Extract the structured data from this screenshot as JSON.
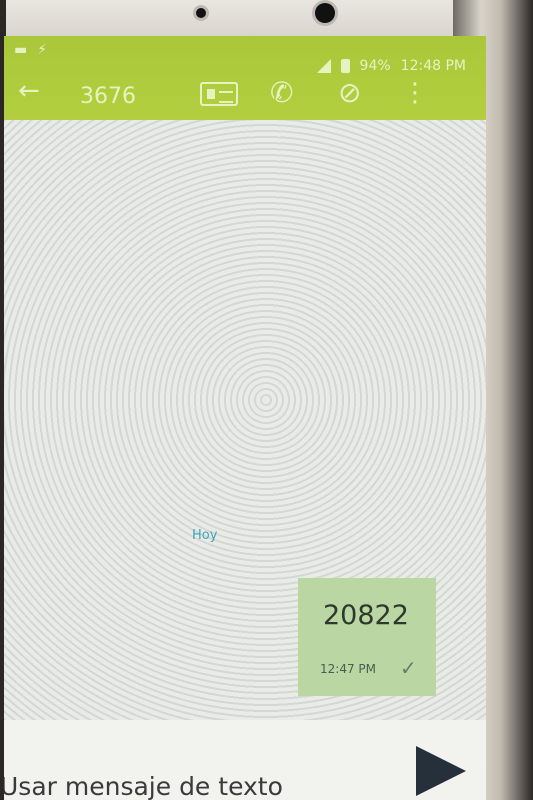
{
  "status_bar": {
    "battery": "94%",
    "time": "12:48 PM"
  },
  "toolbar": {
    "title": "3676"
  },
  "conversation": {
    "date_separator": "Hoy",
    "messages": [
      {
        "text": "20822",
        "time": "12:47 PM",
        "status": "sent"
      }
    ]
  },
  "composer": {
    "placeholder": "Usar mensaje de texto"
  },
  "icons": {
    "back": "back-arrow-icon",
    "contact": "contact-card-icon",
    "call": "phone-icon",
    "attach": "paperclip-icon",
    "more": "more-vert-icon",
    "send": "send-icon"
  },
  "colors": {
    "accent": "#b3cf3f",
    "bubble": "#b9d6a3",
    "date": "#3aa6b9"
  }
}
